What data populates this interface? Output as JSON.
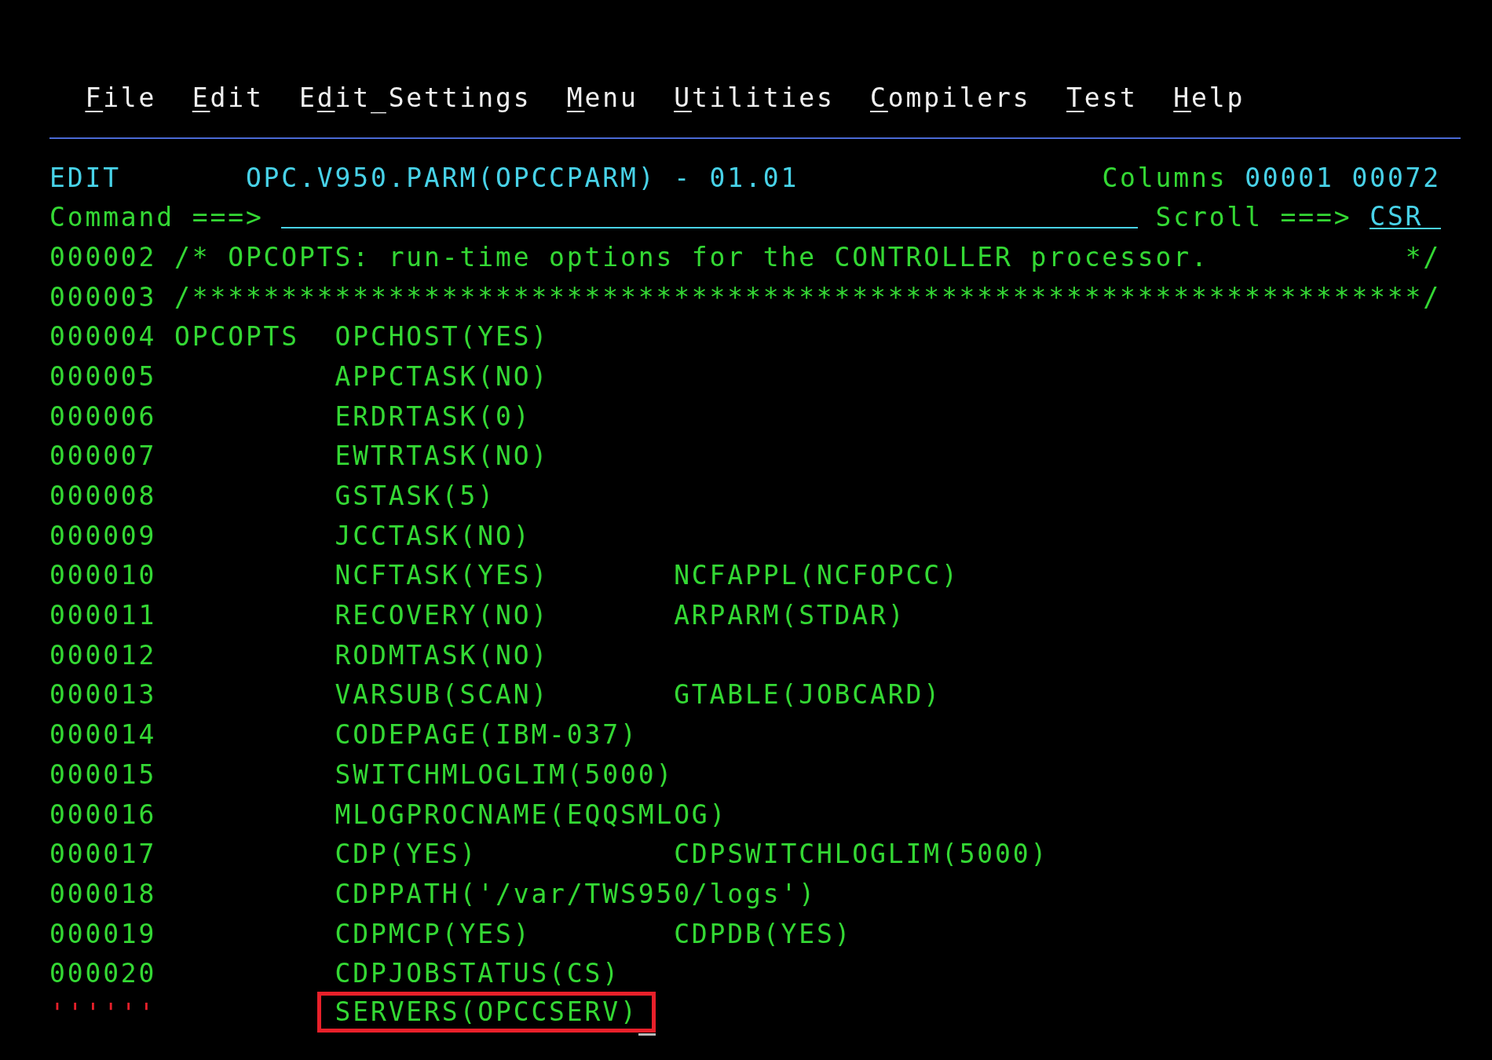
{
  "menu_bar": {
    "items": [
      {
        "label": "**F**ile"
      },
      {
        "label": "**E**dit"
      },
      {
        "label": "E**d**it_Settings"
      },
      {
        "label": "**M**enu"
      },
      {
        "label": "**U**tilities"
      },
      {
        "label": "**C**ompilers"
      },
      {
        "label": "**T**est"
      },
      {
        "label": "**H**elp"
      }
    ]
  },
  "header": {
    "mode": "EDIT",
    "dataset": "OPC.V950.PARM(OPCCPARM) - 01.01",
    "columns_label": "Columns",
    "first_column": "00001",
    "last_column": "00072"
  },
  "command": {
    "label": "Command ===>",
    "scroll_label": "Scroll ===>",
    "scroll_value": "CSR"
  },
  "lines": [
    {
      "number": "000002",
      "kind": "comment",
      "text": "/* OPCOPTS: run-time options for the CONTROLLER processor.",
      "comment_end": "*/"
    },
    {
      "number": "000003",
      "kind": "comment",
      "text": "/*********************************************************************/"
    },
    {
      "number": "000004",
      "kind": "statement",
      "keyword": "OPCOPTS",
      "options": [
        "OPCHOST(YES)"
      ]
    },
    {
      "number": "000005",
      "kind": "statement",
      "options": [
        "APPCTASK(NO)"
      ]
    },
    {
      "number": "000006",
      "kind": "statement",
      "options": [
        "ERDRTASK(0)"
      ]
    },
    {
      "number": "000007",
      "kind": "statement",
      "options": [
        "EWTRTASK(NO)"
      ]
    },
    {
      "number": "000008",
      "kind": "statement",
      "options": [
        "GSTASK(5)"
      ]
    },
    {
      "number": "000009",
      "kind": "statement",
      "options": [
        "JCCTASK(NO)"
      ]
    },
    {
      "number": "000010",
      "kind": "statement",
      "options": [
        "NCFTASK(YES)",
        "NCFAPPL(NCFOPCC)"
      ]
    },
    {
      "number": "000011",
      "kind": "statement",
      "options": [
        "RECOVERY(NO)",
        "ARPARM(STDAR)"
      ]
    },
    {
      "number": "000012",
      "kind": "statement",
      "options": [
        "RODMTASK(NO)"
      ]
    },
    {
      "number": "000013",
      "kind": "statement",
      "options": [
        "VARSUB(SCAN)",
        "GTABLE(JOBCARD)"
      ]
    },
    {
      "number": "000014",
      "kind": "statement",
      "options": [
        "CODEPAGE(IBM-037)"
      ]
    },
    {
      "number": "000015",
      "kind": "statement",
      "options": [
        "SWITCHMLOGLIM(5000)"
      ]
    },
    {
      "number": "000016",
      "kind": "statement",
      "options": [
        "MLOGPROCNAME(EQQSMLOG)"
      ]
    },
    {
      "number": "000017",
      "kind": "statement",
      "options": [
        "CDP(YES)",
        "CDPSWITCHLOGLIM(5000)"
      ]
    },
    {
      "number": "000018",
      "kind": "statement",
      "options": [
        "CDPPATH('/var/TWS950/logs')"
      ]
    },
    {
      "number": "000019",
      "kind": "statement",
      "options": [
        "CDPMCP(YES)",
        "CDPDB(YES)"
      ]
    },
    {
      "number": "000020",
      "kind": "statement",
      "options": [
        "CDPJOBSTATUS(CS)"
      ]
    },
    {
      "number": "''''''",
      "kind": "inserted",
      "options": [
        "SERVERS(OPCCSERV)"
      ],
      "boxed": true,
      "cursor": true
    }
  ]
}
